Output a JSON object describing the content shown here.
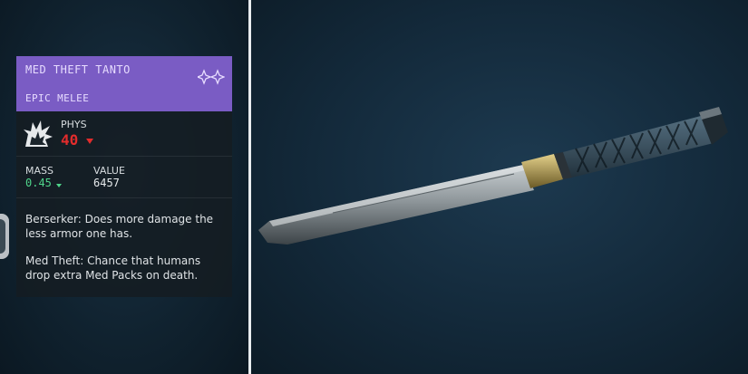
{
  "item": {
    "name": "MED THEFT TANTO",
    "rarity": "EPIC MELEE",
    "stats": {
      "phys_label": "PHYS",
      "phys_value": "40",
      "mass_label": "MASS",
      "mass_value": "0.45",
      "value_label": "VALUE",
      "value_value": "6457"
    },
    "effects": [
      "Berserker: Does more damage the less armor one has.",
      "Med Theft: Chance that humans drop extra Med Packs on death."
    ]
  },
  "colors": {
    "header_purple": "#7a5cc4",
    "damage_red": "#e22c2c",
    "mass_green": "#4fd48a",
    "divider": "#e8ecef"
  },
  "icons": {
    "rarity": "sparkle-icon",
    "phys": "explosion-icon",
    "phys_delta": "down-triangle-icon",
    "mass_delta": "down-triangle-icon"
  }
}
